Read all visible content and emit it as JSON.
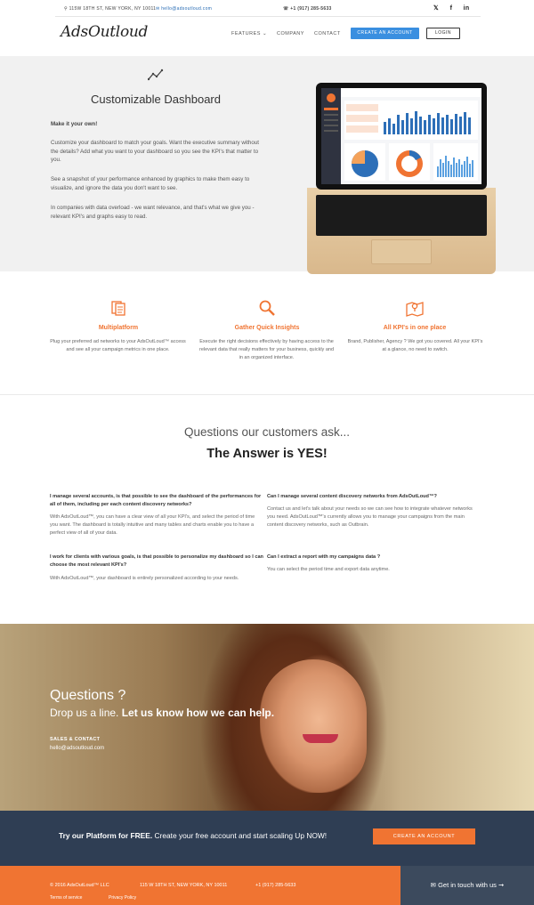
{
  "topbar": {
    "address": "115W 18TH ST, NEW YORK, NY 10011",
    "email": "hello@adsoutloud.com",
    "phone": "+1 (917) 285-5633",
    "social": [
      "twitter-icon",
      "facebook-icon",
      "linkedin-icon"
    ],
    "social_glyphs": [
      "𝕏",
      "f",
      "in"
    ]
  },
  "header": {
    "logo": "AdsOutloud",
    "nav": [
      "FEATURES",
      "COMPANY",
      "CONTACT"
    ],
    "nav_caret": "⌄",
    "create_account": "CREATE AN ACCOUNT",
    "login": "LOGIN"
  },
  "dashboard": {
    "title": "Customizable Dashboard",
    "lead": "Make it your own!",
    "paragraphs": [
      "Customize your dashboard to match your goals. Want the executive summary without the details? Add what you want to your dashboard so you see the KPI's that matter to you.",
      "See a snapshot of your performance enhanced by graphics to make them easy to visualize, and ignore the data you don't want to see.",
      "In companies with data overload - we want relevance, and that's what we give you - relevant KPI's and graphs easy to read."
    ]
  },
  "features": [
    {
      "icon": "documents-icon",
      "title": "Multiplatform",
      "desc": "Plug your preferred ad networks to your AdsOutLoud™ access and see all your campaign metrics in one place."
    },
    {
      "icon": "magnifier-icon",
      "title": "Gather Quick Insights",
      "desc": "Execute the right decisions effectively by having access to the relevant data that really matters for your business, quickly and in an organized interface."
    },
    {
      "icon": "map-icon",
      "title": "All KPI's in one place",
      "desc": "Brand, Publisher, Agency ? We got you covered. All your KPI's at a glance, no need to switch."
    }
  ],
  "faq": {
    "subtitle": "Questions our customers ask...",
    "title": "The Answer is YES!",
    "items": [
      {
        "q": "I manage several accounts, is that possible to see the dashboard of the performances for all of them, including per each content discovery networks?",
        "a": "With AdsOutLoud™, you can have a clear view of all your KPI's, and select the period of time you want. The dashboard is totally intuitive and many tables and charts enable you to have a perfect view of all of your data."
      },
      {
        "q": "Can I manage several content discovery networks from AdsOutLoud™?",
        "a": "Contact us and let's talk about your needs so we can see how to integrate whatever networks you need. AdsOutLoud™'s currently allows you to manage your campaigns from the main content discovery networks, such as Outbrain."
      },
      {
        "q": "I work for clients with various goals, is that possible to personalize my dashboard so I can choose the most relevant KPI's?",
        "a": "With AdsOutLoud™, your dashboard is entirely personalized according to your needs."
      },
      {
        "q": "Can I extract a report with my campaigns data ?",
        "a": "You can select the period time and export data anytime."
      }
    ]
  },
  "hero": {
    "questions": "Questions ?",
    "line_plain": "Drop us a line. ",
    "line_bold": "Let us know how we can help.",
    "sales_label": "SALES & CONTACT",
    "email": "hello@adsoutloud.com"
  },
  "cta": {
    "bold": "Try our Platform for FREE.",
    "text": " Create your free account and start scaling Up NOW!",
    "button": "CREATE AN ACCOUNT"
  },
  "footer": {
    "copyright": "© 2016 AdsOutLoud™ LLC",
    "address": "115 W 18TH ST, NEW YORK, NY 10011",
    "phone": "+1 (917) 285-5633",
    "terms": "Terms of service",
    "privacy": "Privacy Policy",
    "get_in_touch": "Get in touch with us ➞"
  },
  "colors": {
    "accent": "#f07432",
    "blue": "#3a8fe0",
    "navy": "#2f3e54"
  }
}
